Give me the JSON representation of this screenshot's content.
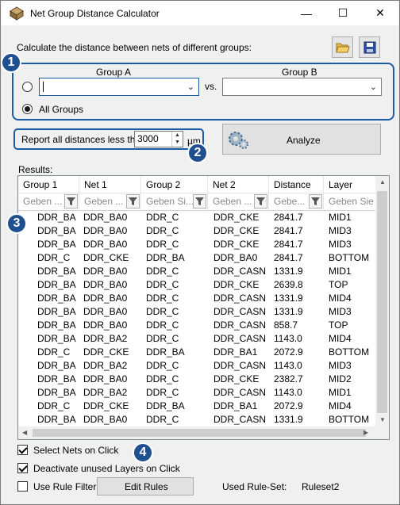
{
  "window": {
    "title": "Net Group Distance Calculator",
    "controls": {
      "minimize": "—",
      "maximize": "☐",
      "close": "✕"
    }
  },
  "description": "Calculate the distance between nets of different groups:",
  "toolbar": {
    "open_icon": "folder-open-icon",
    "save_icon": "save-disk-icon"
  },
  "groups": {
    "group_a_label": "Group A",
    "group_b_label": "Group B",
    "group_a_value": "",
    "group_b_value": "",
    "vs_label": "vs.",
    "all_groups_label": "All Groups",
    "selected_option": "All Groups"
  },
  "report": {
    "label": "Report all distances less than",
    "value": "3000",
    "unit": "µm"
  },
  "analyze_label": "Analyze",
  "results_label": "Results:",
  "table": {
    "columns": [
      {
        "header": "Group 1",
        "filter": "Geben ..."
      },
      {
        "header": "Net 1",
        "filter": "Geben ..."
      },
      {
        "header": "Group 2",
        "filter": "Geben Si..."
      },
      {
        "header": "Net 2",
        "filter": "Geben ..."
      },
      {
        "header": "Distance",
        "filter": "Gebe..."
      },
      {
        "header": "Layer",
        "filter": "Geben Sie T"
      }
    ],
    "rows": [
      [
        "DDR_BA",
        "DDR_BA0",
        "DDR_C",
        "DDR_CKE",
        "2841.7",
        "MID1"
      ],
      [
        "DDR_BA",
        "DDR_BA0",
        "DDR_C",
        "DDR_CKE",
        "2841.7",
        "MID3"
      ],
      [
        "DDR_BA",
        "DDR_BA0",
        "DDR_C",
        "DDR_CKE",
        "2841.7",
        "MID3"
      ],
      [
        "DDR_C",
        "DDR_CKE",
        "DDR_BA",
        "DDR_BA0",
        "2841.7",
        "BOTTOM"
      ],
      [
        "DDR_BA",
        "DDR_BA0",
        "DDR_C",
        "DDR_CASN",
        "1331.9",
        "MID1"
      ],
      [
        "DDR_BA",
        "DDR_BA0",
        "DDR_C",
        "DDR_CKE",
        "2639.8",
        "TOP"
      ],
      [
        "DDR_BA",
        "DDR_BA0",
        "DDR_C",
        "DDR_CASN",
        "1331.9",
        "MID4"
      ],
      [
        "DDR_BA",
        "DDR_BA0",
        "DDR_C",
        "DDR_CASN",
        "1331.9",
        "MID3"
      ],
      [
        "DDR_BA",
        "DDR_BA0",
        "DDR_C",
        "DDR_CASN",
        "858.7",
        "TOP"
      ],
      [
        "DDR_BA",
        "DDR_BA2",
        "DDR_C",
        "DDR_CASN",
        "1143.0",
        "MID4"
      ],
      [
        "DDR_C",
        "DDR_CKE",
        "DDR_BA",
        "DDR_BA1",
        "2072.9",
        "BOTTOM"
      ],
      [
        "DDR_BA",
        "DDR_BA2",
        "DDR_C",
        "DDR_CASN",
        "1143.0",
        "MID3"
      ],
      [
        "DDR_BA",
        "DDR_BA0",
        "DDR_C",
        "DDR_CKE",
        "2382.7",
        "MID2"
      ],
      [
        "DDR_BA",
        "DDR_BA2",
        "DDR_C",
        "DDR_CASN",
        "1143.0",
        "MID1"
      ],
      [
        "DDR_C",
        "DDR_CKE",
        "DDR_BA",
        "DDR_BA1",
        "2072.9",
        "MID4"
      ],
      [
        "DDR_BA",
        "DDR_BA0",
        "DDR_C",
        "DDR_CASN",
        "1331.9",
        "BOTTOM"
      ]
    ]
  },
  "options": {
    "select_nets": {
      "label": "Select Nets on Click",
      "checked": true
    },
    "deactivate_layers": {
      "label": "Deactivate unused Layers on Click",
      "checked": true
    },
    "use_rule_filter": {
      "label": "Use Rule Filter",
      "checked": false
    }
  },
  "edit_rules_label": "Edit Rules",
  "ruleset": {
    "label": "Used Rule-Set:",
    "value": "Ruleset2"
  },
  "callouts": [
    "1",
    "2",
    "3",
    "4"
  ],
  "colors": {
    "callout_blue": "#1f4f8f",
    "highlight_border": "#1a5ba6"
  }
}
